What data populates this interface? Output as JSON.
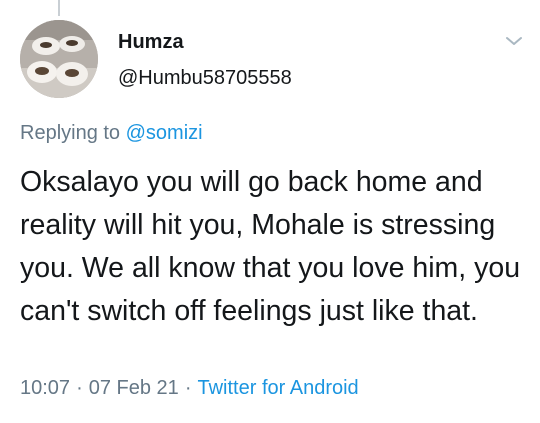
{
  "tweet": {
    "author": {
      "display_name": "Humza",
      "handle": "@Humbu58705558"
    },
    "replying_to": {
      "prefix": "Replying to",
      "mention": "@somizi"
    },
    "text": "Oksalayo you will go back home and reality will hit you, Mohale is stressing you. We all know that you love him, you can't switch off feelings just like that.",
    "time": "10:07",
    "date": "07 Feb 21",
    "separator": "·",
    "source": "Twitter for Android"
  },
  "icons": {
    "menu": "chevron-down-icon"
  },
  "colors": {
    "text_primary": "#14171a",
    "text_secondary": "#657786",
    "link": "#1b95e0",
    "thread_line": "#c9cfd4"
  }
}
